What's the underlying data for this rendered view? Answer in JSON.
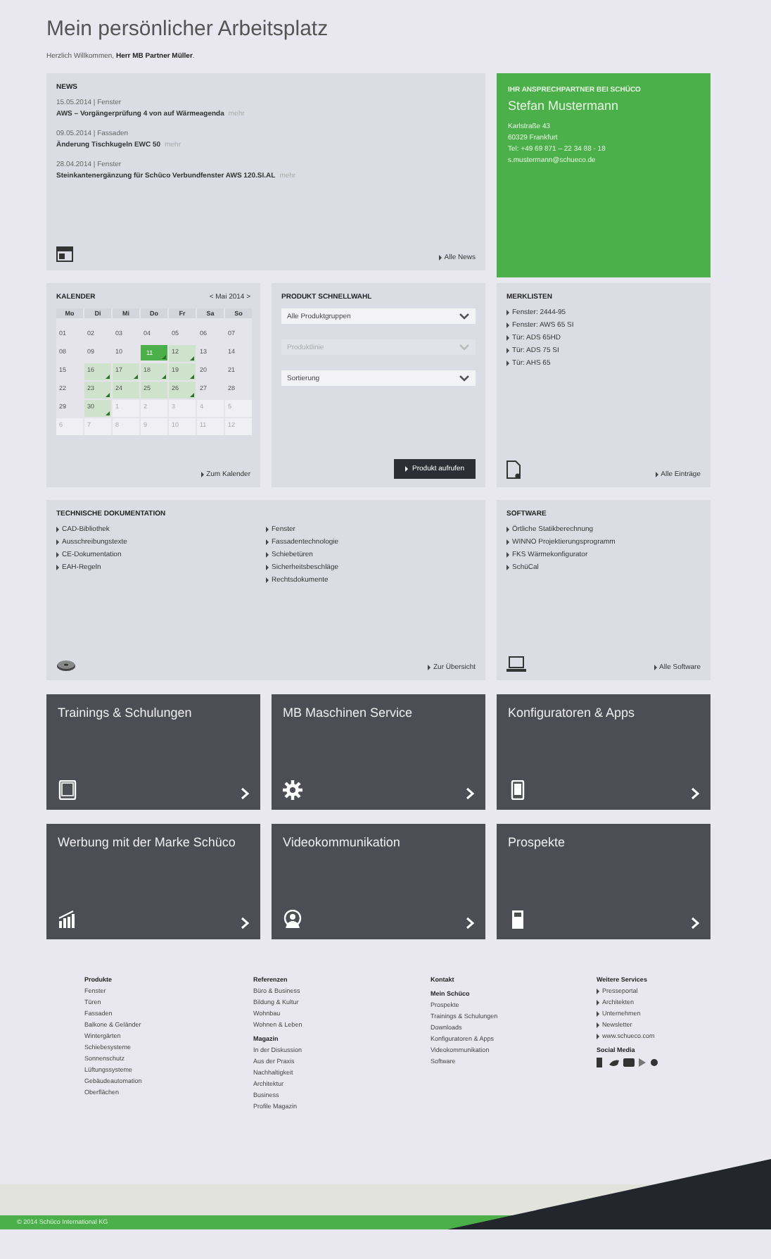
{
  "page": {
    "title": "Mein persönlicher Arbeitsplatz",
    "welcome": "Herzlich Willkommen, **Herr MB Partner Müller**."
  },
  "news": {
    "heading": "NEWS",
    "items": [
      {
        "meta": "15.05.2014 | Fenster",
        "title": "AWS – Vorgängerprüfung 4 von auf Wärmeagenda",
        "more": "mehr"
      },
      {
        "meta": "09.05.2014 | Fassaden",
        "title": "Änderung Tischkugeln EWC 50",
        "more": "mehr"
      },
      {
        "meta": "28.04.2014 | Fenster",
        "title": "Steinkantenergänzung für Schüco Verbundfenster AWS 120.SI.AL",
        "more": "mehr"
      }
    ],
    "link": "Alle News"
  },
  "contact": {
    "heading": "IHR ANSPRECHPARTNER BEI SCHÜCO",
    "name": "Stefan Mustermann",
    "lines": [
      "Karlstraße 43",
      "60329 Frankfurt",
      "Tel: +49 69 871 – 22 34 88 - 18",
      "s.mustermann@schueco.de"
    ]
  },
  "calendar": {
    "heading": "KALENDER",
    "month": "< Mai 2014 >",
    "weekdays": [
      "Mo",
      "Di",
      "Mi",
      "Do",
      "Fr",
      "Sa",
      "So"
    ],
    "weeks": [
      [
        {
          "day": "01",
          "selected": false,
          "event": false,
          "range": false,
          "other_month": false
        },
        {
          "day": "02",
          "selected": false,
          "event": false,
          "range": false,
          "other_month": false
        },
        {
          "day": "03",
          "selected": false,
          "event": false,
          "range": false,
          "other_month": false
        },
        {
          "day": "04",
          "selected": false,
          "event": false,
          "range": false,
          "other_month": false
        },
        {
          "day": "05",
          "selected": false,
          "event": false,
          "range": false,
          "other_month": false
        },
        {
          "day": "06",
          "selected": false,
          "event": false,
          "range": false,
          "other_month": false
        },
        {
          "day": "07",
          "selected": false,
          "event": false,
          "range": false,
          "other_month": false
        }
      ],
      [
        {
          "day": "08",
          "selected": false,
          "event": false,
          "range": false,
          "other_month": false
        },
        {
          "day": "09",
          "selected": false,
          "event": false,
          "range": false,
          "other_month": false
        },
        {
          "day": "10",
          "selected": false,
          "event": false,
          "range": false,
          "other_month": false
        },
        {
          "day": "11",
          "selected": true,
          "event": true,
          "range": false,
          "other_month": false
        },
        {
          "day": "12",
          "selected": false,
          "event": true,
          "range": true,
          "other_month": false
        },
        {
          "day": "13",
          "selected": false,
          "event": false,
          "range": false,
          "other_month": false
        },
        {
          "day": "14",
          "selected": false,
          "event": false,
          "range": false,
          "other_month": false
        }
      ],
      [
        {
          "day": "15",
          "selected": false,
          "event": false,
          "range": false,
          "other_month": false
        },
        {
          "day": "16",
          "selected": false,
          "event": true,
          "range": true,
          "other_month": false
        },
        {
          "day": "17",
          "selected": false,
          "event": true,
          "range": true,
          "other_month": false
        },
        {
          "day": "18",
          "selected": false,
          "event": true,
          "range": true,
          "other_month": false
        },
        {
          "day": "19",
          "selected": false,
          "event": true,
          "range": true,
          "other_month": false
        },
        {
          "day": "20",
          "selected": false,
          "event": false,
          "range": false,
          "other_month": false
        },
        {
          "day": "21",
          "selected": false,
          "event": false,
          "range": false,
          "other_month": false
        }
      ],
      [
        {
          "day": "22",
          "selected": false,
          "event": false,
          "range": false,
          "other_month": false
        },
        {
          "day": "23",
          "selected": false,
          "event": true,
          "range": true,
          "other_month": false
        },
        {
          "day": "24",
          "selected": false,
          "event": false,
          "range": true,
          "other_month": false
        },
        {
          "day": "25",
          "selected": false,
          "event": false,
          "range": true,
          "other_month": false
        },
        {
          "day": "26",
          "selected": false,
          "event": true,
          "range": true,
          "other_month": false
        },
        {
          "day": "27",
          "selected": false,
          "event": false,
          "range": false,
          "other_month": false
        },
        {
          "day": "28",
          "selected": false,
          "event": false,
          "range": false,
          "other_month": false
        }
      ],
      [
        {
          "day": "29",
          "selected": false,
          "event": false,
          "range": false,
          "other_month": false
        },
        {
          "day": "30",
          "selected": false,
          "event": true,
          "range": true,
          "other_month": false
        },
        {
          "day": "1",
          "selected": false,
          "event": false,
          "range": false,
          "other_month": true
        },
        {
          "day": "2",
          "selected": false,
          "event": false,
          "range": false,
          "other_month": true
        },
        {
          "day": "3",
          "selected": false,
          "event": false,
          "range": false,
          "other_month": true
        },
        {
          "day": "4",
          "selected": false,
          "event": false,
          "range": false,
          "other_month": true
        },
        {
          "day": "5",
          "selected": false,
          "event": false,
          "range": false,
          "other_month": true
        }
      ],
      [
        {
          "day": "6",
          "selected": false,
          "event": false,
          "range": false,
          "other_month": true
        },
        {
          "day": "7",
          "selected": false,
          "event": false,
          "range": false,
          "other_month": true
        },
        {
          "day": "8",
          "selected": false,
          "event": false,
          "range": false,
          "other_month": true
        },
        {
          "day": "9",
          "selected": false,
          "event": false,
          "range": false,
          "other_month": true
        },
        {
          "day": "10",
          "selected": false,
          "event": false,
          "range": false,
          "other_month": true
        },
        {
          "day": "11",
          "selected": false,
          "event": false,
          "range": false,
          "other_month": true
        },
        {
          "day": "12",
          "selected": false,
          "event": false,
          "range": false,
          "other_month": true
        }
      ]
    ],
    "link": "Zum Kalender"
  },
  "quick_select": {
    "heading": "PRODUKT SCHNELLWAHL",
    "selects": [
      {
        "value": "Alle Produktgruppen",
        "disabled": false
      },
      {
        "placeholder": "Produktlinie",
        "disabled": true
      },
      {
        "value": "Sortierung",
        "disabled": false
      }
    ],
    "button": "Produkt aufrufen"
  },
  "watchlists": {
    "heading": "MERKLISTEN",
    "items": [
      "Fenster: 2444-95",
      "Fenster: AWS 65 SI",
      "Tür: ADS 65HD",
      "Tür: ADS 75 SI",
      "Tür: AHS 65"
    ],
    "link": "Alle Einträge"
  },
  "documentation": {
    "heading": "TECHNISCHE DOKUMENTATION",
    "columns": [
      [
        "CAD-Bibliothek",
        "Ausschreibungstexte",
        "CE-Dokumentation",
        "EAH-Regeln"
      ],
      [
        "Fenster",
        "Fassadentechnologie",
        "Schiebetüren",
        "Sicherheitsbeschläge",
        "Rechtsdokumente"
      ]
    ],
    "link": "Zur Übersicht"
  },
  "software": {
    "heading": "SOFTWARE",
    "items": [
      "Örtliche Statikberechnung",
      "WINNO Projektierungsprogramm",
      "FKS Wärmekonfigurator",
      "SchüCal"
    ],
    "link": "Alle Software"
  },
  "tiles": [
    {
      "title": "Trainings & Schulungen",
      "kind": "tablet"
    },
    {
      "title": "MB Maschinen Service",
      "kind": "gear"
    },
    {
      "title": "Konfiguratoren & Apps",
      "kind": "phone"
    },
    {
      "title": "Werbung mit der Marke Schüco",
      "kind": "chart"
    },
    {
      "title": "Videokommunikation",
      "kind": "webcam"
    },
    {
      "title": "Prospekte",
      "kind": "brochure"
    }
  ],
  "footer": {
    "columns": [
      [
        {
          "heading": "Produkte",
          "links": [
            "Fenster",
            "Türen",
            "Fassaden",
            "Balkone & Geländer",
            "Wintergärten",
            "Schiebesysteme",
            "Sonnenschutz",
            "Lüftungssysteme",
            "Gebäudeautomation",
            "Oberflächen"
          ]
        }
      ],
      [
        {
          "heading": "Referenzen",
          "links": [
            "Büro & Business",
            "Bildung & Kultur",
            "Wohnbau",
            "Wohnen & Leben"
          ]
        },
        {
          "heading": "Magazin",
          "links": [
            "In der Diskussion",
            "Aus der Praxis",
            "Nachhaltigkeit",
            "Architektur",
            "Business",
            "Profile Magazin"
          ]
        }
      ],
      [
        {
          "heading": "Kontakt"
        },
        {
          "heading": "Mein Schüco",
          "links": [
            "Prospekte",
            "Trainings & Schulungen",
            "Downloads",
            "Konfiguratoren & Apps",
            "Videokommunikation",
            "Software"
          ]
        }
      ],
      [
        {
          "heading": "Weitere Services",
          "links": [
            "Presseportal",
            "Architekten",
            "Unternehmen",
            "Newsletter",
            "www.schueco.com"
          ]
        },
        {
          "heading": "Social Media"
        }
      ]
    ],
    "copyright": "© 2014 Schüco International KG"
  }
}
